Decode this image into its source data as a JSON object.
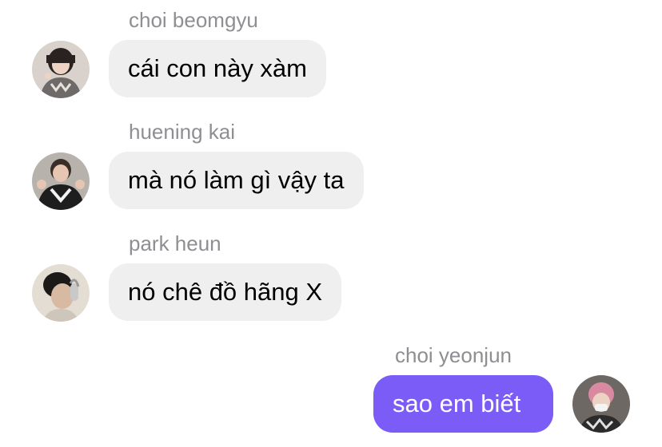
{
  "messages": [
    {
      "sender": "choi beomgyu",
      "text": "cái con này xàm",
      "direction": "incoming",
      "avatar_icon": "avatar-photo-beomgyu"
    },
    {
      "sender": "huening kai",
      "text": "mà nó làm gì vậy ta",
      "direction": "incoming",
      "avatar_icon": "avatar-photo-kai"
    },
    {
      "sender": "park heun",
      "text": "nó chê đồ hãng X",
      "direction": "incoming",
      "avatar_icon": "avatar-photo-heun"
    },
    {
      "sender": "choi yeonjun",
      "text": "sao em biết",
      "direction": "outgoing",
      "avatar_icon": "avatar-photo-yeonjun"
    }
  ],
  "colors": {
    "incoming_bubble": "#efeff0",
    "outgoing_bubble": "#7c5cf6",
    "sender_name": "#8e8e93"
  }
}
